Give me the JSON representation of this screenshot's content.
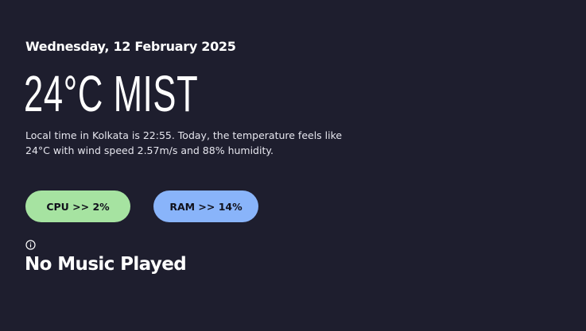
{
  "date": "Wednesday, 12 February 2025",
  "weather": {
    "headline": "24°C MIST",
    "description": "Local time in Kolkata is 22:55. Today, the temperature feels like 24°C with wind speed 2.57m/s and 88% humidity."
  },
  "system": {
    "cpu_label": "CPU >> 2%",
    "ram_label": "RAM >> 14%"
  },
  "music": {
    "icon": "info-icon",
    "status": "No Music Played"
  },
  "colors": {
    "background": "#1e1e2e",
    "cpu_pill": "#a6e3a1",
    "ram_pill": "#89b4fa",
    "text": "#ffffff"
  }
}
